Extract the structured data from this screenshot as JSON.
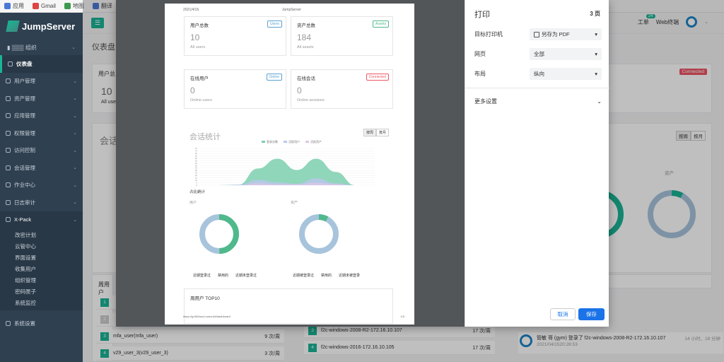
{
  "bookmarks": [
    "应用",
    "Gmail",
    "地图",
    "翻译"
  ],
  "app": {
    "title": "JumpServer",
    "org": "组织"
  },
  "sidebar": {
    "items": [
      {
        "label": "仪表盘",
        "active": true
      },
      {
        "label": "用户管理"
      },
      {
        "label": "资产管理"
      },
      {
        "label": "应用管理"
      },
      {
        "label": "权限管理"
      },
      {
        "label": "访问控制"
      },
      {
        "label": "会话管理"
      },
      {
        "label": "作业中心"
      },
      {
        "label": "日志审计"
      }
    ],
    "xpack": "X-Pack",
    "sub": [
      "改密计划",
      "云管中心",
      "界面设置",
      "收集用户",
      "组织管理",
      "密码匣子",
      "系统监控"
    ],
    "settings": "系统设置"
  },
  "topbar": {
    "tickets": "工单",
    "ticket_count": "24",
    "web_terminal": "Web终端"
  },
  "main": {
    "breadcrumb": "仪表盘",
    "users_title": "用户总",
    "users_num": "10",
    "users_sub": "All user",
    "connected": "Connected",
    "sessions_title": "会话",
    "week": "按周",
    "month": "按月",
    "assets_label": "资产",
    "weekly_title": "周用户",
    "rows_left": [
      {
        "idx": "1",
        "name": "",
        "count": ""
      },
      {
        "idx": "2",
        "name": "",
        "count": ""
      },
      {
        "idx": "3",
        "name": "mfa_user(mfa_user)",
        "count": "9 次/周"
      },
      {
        "idx": "4",
        "name": "v29_user_3(v29_user_3)",
        "count": "3 次/周"
      }
    ],
    "rows_mid": [
      {
        "idx": "3",
        "name": "f2c-windows-2008-R2-172.16.10.107",
        "count": "17 次/周"
      },
      {
        "idx": "4",
        "name": "f2c-windows-2016-172.16.10.105",
        "count": "17 次/周"
      }
    ],
    "log": {
      "text": "管敏 哥 (gym) 登录了 f2c-windows-2008-R2-172.16.10.107",
      "time": "2021/04/1520:28:53",
      "ago": "14 小时、18 分钟"
    }
  },
  "print": {
    "title": "打印",
    "pages": "3 页",
    "dest_label": "目标打印机",
    "dest_value": "另存为 PDF",
    "pages_label": "网页",
    "pages_value": "全部",
    "layout_label": "布局",
    "layout_value": "纵向",
    "more": "更多设置",
    "cancel": "取消",
    "save": "保存"
  },
  "preview": {
    "date": "2021/4/16",
    "header": "JumpServer",
    "cards": [
      {
        "title": "用户总数",
        "label": "Users",
        "num": "10",
        "sub": "All users"
      },
      {
        "title": "资产总数",
        "label": "Assets",
        "num": "184",
        "sub": "All assets"
      },
      {
        "title": "在线用户",
        "label": "Online",
        "num": "0",
        "sub": "Online users"
      },
      {
        "title": "在线会话",
        "label": "Connected",
        "num": "0",
        "sub": "Online sessions"
      }
    ],
    "session_title": "会话统计",
    "week": "按周",
    "month": "按月",
    "legend": [
      "登录次数",
      "活跃用户",
      "活跃资产"
    ],
    "ratio": "占比统计",
    "users": "用户",
    "assets": "资产",
    "users_legend": [
      "近期登录过",
      "禁用的",
      "近期未登录过"
    ],
    "assets_legend": [
      "近期被登录过",
      "禁用的",
      "近期未被登录"
    ],
    "top10": "周用户 TOP10",
    "url": "https://jy.fit2cloud.com/ui/#/dashboard",
    "page_no": "1/3"
  },
  "chart_data": {
    "type": "area",
    "yticks": [
      "75",
      "70",
      "65",
      "60",
      "55",
      "50",
      "45",
      "40",
      "35",
      "30",
      "25",
      "20",
      "15",
      "10",
      "5",
      "0"
    ],
    "series": [
      {
        "name": "登录次数",
        "color": "#7ccfae",
        "values": [
          0,
          0,
          1,
          34,
          54,
          31,
          54,
          27,
          0,
          0
        ]
      },
      {
        "name": "活跃用户",
        "color": "#b8c8e8",
        "values": [
          0,
          0,
          1,
          11,
          6,
          3,
          14,
          4,
          0,
          0
        ]
      },
      {
        "name": "活跃资产",
        "color": "#d9c7e8",
        "values": [
          0,
          0,
          0,
          4,
          2,
          2,
          5,
          2,
          0,
          0
        ]
      }
    ],
    "ylim": [
      0,
      75
    ]
  }
}
